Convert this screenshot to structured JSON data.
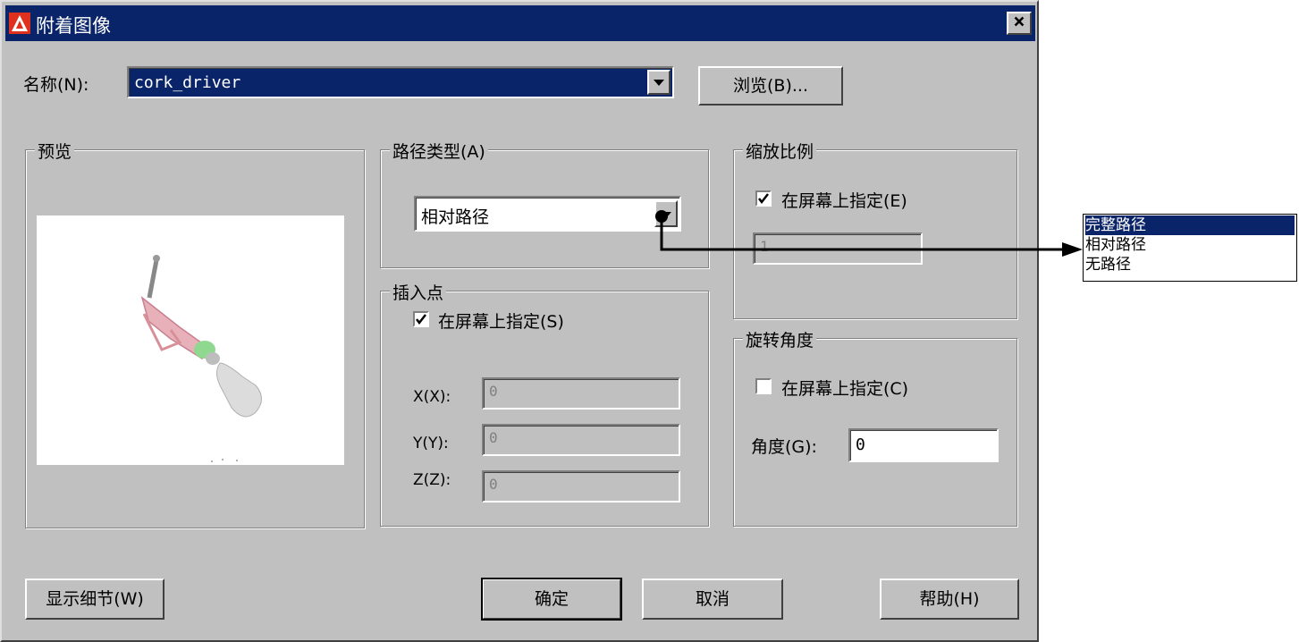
{
  "dialog": {
    "title": "附着图像",
    "close_label": "×"
  },
  "name_row": {
    "label": "名称(N):",
    "value": "cork_driver",
    "browse_label": "浏览(B)..."
  },
  "preview": {
    "title": "预览"
  },
  "path_type": {
    "title": "路径类型(A)",
    "value": "相对路径"
  },
  "insertion_point": {
    "title": "插入点",
    "specify_on_screen": "在屏幕上指定(S)",
    "specify_checked": true,
    "x_label": "X(X):",
    "x_value": "0",
    "y_label": "Y(Y):",
    "y_value": "0",
    "z_label": "Z(Z):",
    "z_value": "0"
  },
  "scale": {
    "title": "缩放比例",
    "specify_on_screen": "在屏幕上指定(E)",
    "specify_checked": true,
    "value": "1"
  },
  "rotation": {
    "title": "旋转角度",
    "specify_on_screen": "在屏幕上指定(C)",
    "specify_checked": false,
    "angle_label": "角度(G):",
    "angle_value": "0"
  },
  "buttons": {
    "details": "显示细节(W)",
    "ok": "确定",
    "cancel": "取消",
    "help": "帮助(H)"
  },
  "path_options_popup": {
    "items": [
      "完整路径",
      "相对路径",
      "无路径"
    ],
    "selected_index": 0
  },
  "colors": {
    "title_bar": "#0a246a",
    "dialog_face": "#c0c0c0",
    "app_icon": "#e0301e"
  },
  "icons": [
    "autocad-app-icon",
    "close-icon",
    "dropdown-arrow-icon",
    "checkmark-icon"
  ]
}
